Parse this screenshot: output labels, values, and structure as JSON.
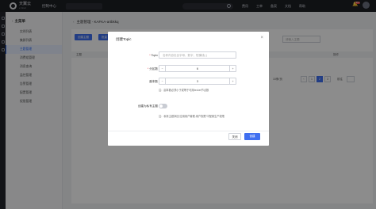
{
  "topbar": {
    "brand": "天翼云",
    "brand_sub": "e Cloud",
    "console": "控制中心",
    "region": "",
    "nav": [
      "费用",
      "工单",
      "备案",
      "文档",
      "帮助"
    ],
    "badge": "99+"
  },
  "sidebar": {
    "title": "主菜单",
    "items": [
      {
        "label": "实例列表",
        "active": false
      },
      {
        "label": "集群列表",
        "active": false
      },
      {
        "label": "主题管理",
        "active": true
      },
      {
        "label": "消费组管理",
        "active": false
      },
      {
        "label": "消息查询",
        "active": false
      },
      {
        "label": "监控管理",
        "active": false
      },
      {
        "label": "告警管理",
        "active": false
      },
      {
        "label": "配置管理",
        "active": false
      },
      {
        "label": "权限管理",
        "active": false
      }
    ]
  },
  "main": {
    "breadcrumb": "主题管理 - KAFKA-artbkkq",
    "buttons": [
      "创建主题",
      "批量"
    ],
    "search_placeholder": "请输入主题",
    "columns": [
      "主题",
      "操作"
    ],
    "pagination": {
      "per_page": "10条/页",
      "pages": [
        "1",
        "2",
        "3"
      ],
      "current": "2",
      "goto_label": "前往"
    }
  },
  "modal": {
    "title": "创建Topic",
    "close": "×",
    "fields": {
      "topic_label": "Topic",
      "topic_placeholder": "名称内容包含字母、数字、短横线(-)",
      "partition_label": "分区数",
      "partition_value": "6",
      "replica_label": "副本数",
      "replica_value": "3",
      "replica_hint": "注：副本数必须小于或等于可用broker节点数",
      "private_label": "创建为私有主题",
      "private_hint": "注：私有主题添加“应用用户管理-用户权限”中配置生产权限"
    },
    "cancel": "关闭",
    "ok": "创建"
  }
}
